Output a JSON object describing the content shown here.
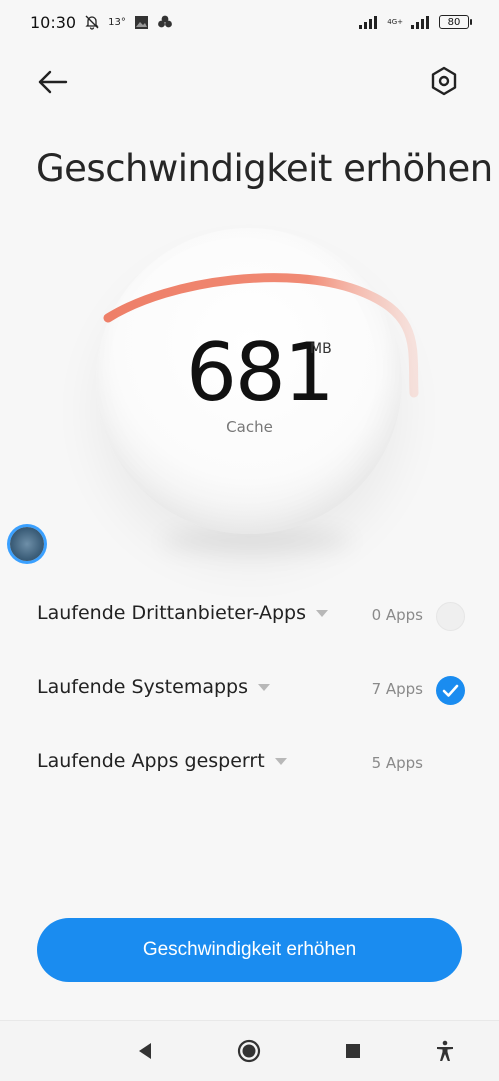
{
  "status_bar": {
    "time": "10:30",
    "temperature": "13°",
    "network": "4G+",
    "battery": "80"
  },
  "header": {
    "title": "Geschwindigkeit erhöhen"
  },
  "cache": {
    "value": "681",
    "unit": "MB",
    "label": "Cache"
  },
  "list": [
    {
      "label": "Laufende Drittanbieter-Apps",
      "count": "0 Apps",
      "checked": false
    },
    {
      "label": "Laufende Systemapps",
      "count": "7 Apps",
      "checked": true
    },
    {
      "label": "Laufende Apps gesperrt",
      "count": "5 Apps",
      "checked": null
    }
  ],
  "action": {
    "button_label": "Geschwindigkeit erhöhen"
  },
  "colors": {
    "accent": "#1a8cf0",
    "arc": "#ee7f68",
    "background": "#f7f7f7"
  },
  "icons": {
    "back": "arrow-left-icon",
    "settings": "hexagon-settings-icon",
    "nav_back": "triangle-back-icon",
    "nav_home": "circle-home-icon",
    "nav_recents": "square-recents-icon",
    "accessibility": "accessibility-icon"
  }
}
